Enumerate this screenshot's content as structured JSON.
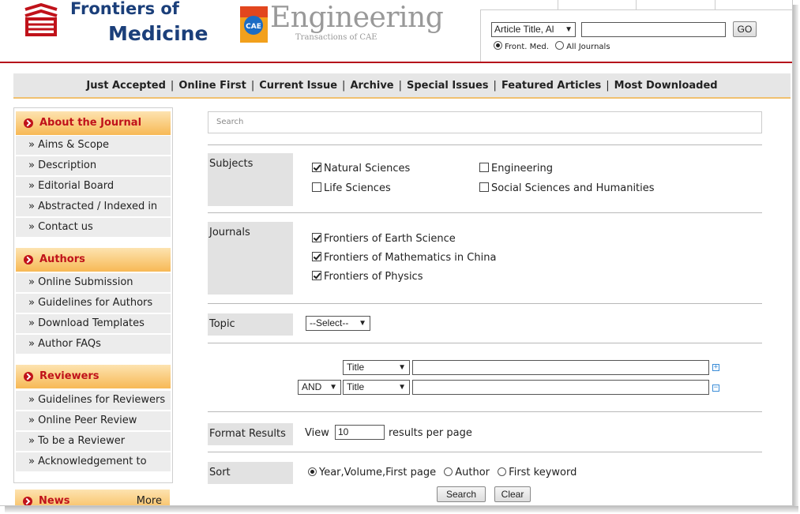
{
  "header": {
    "journal_line1": "Frontiers of",
    "journal_line2": "Medicine",
    "partner_badge_text": "CAE",
    "partner_title": "Engineering",
    "partner_subtitle": "Transactions of CAE"
  },
  "quick_search": {
    "field_select": "Article Title, Al",
    "query_value": "",
    "go_label": "GO",
    "scope_options": [
      {
        "label": "Front. Med.",
        "selected": true
      },
      {
        "label": "All Journals",
        "selected": false
      }
    ]
  },
  "nav": {
    "items": [
      "Just Accepted",
      "Online First",
      "Current Issue",
      "Archive",
      "Special Issues",
      "Featured Articles",
      "Most Downloaded"
    ]
  },
  "sidebar": {
    "sections": [
      {
        "title": "About the Journal",
        "items": [
          "» Aims & Scope",
          "» Description",
          "» Editorial Board",
          "» Abstracted / Indexed in",
          "» Contact us"
        ]
      },
      {
        "title": "Authors",
        "items": [
          "» Online Submission",
          "» Guidelines for Authors",
          "» Download Templates",
          "» Author FAQs"
        ]
      },
      {
        "title": "Reviewers",
        "items": [
          "» Guidelines for Reviewers",
          "» Online Peer Review",
          "» To be a Reviewer",
          "» Acknowledgement to"
        ]
      },
      {
        "title": "News",
        "more": "More",
        "items": []
      }
    ]
  },
  "advanced_search": {
    "search_placeholder": "Search",
    "subjects_label": "Subjects",
    "subjects": [
      {
        "label": "Natural Sciences",
        "checked": true
      },
      {
        "label": "Engineering",
        "checked": false
      },
      {
        "label": "Life Sciences",
        "checked": false
      },
      {
        "label": "Social Sciences and Humanities",
        "checked": false
      }
    ],
    "journals_label": "Journals",
    "journals": [
      {
        "label": "Frontiers of Earth Science",
        "checked": true
      },
      {
        "label": "Frontiers of Mathematics in China",
        "checked": true
      },
      {
        "label": "Frontiers of Physics",
        "checked": true
      }
    ],
    "topic_label": "Topic",
    "topic_select": "--Select--",
    "field_row1_select": "Title",
    "field_row2_operator": "AND",
    "field_row2_select": "Title",
    "format_label": "Format Results",
    "view_label": "View",
    "per_page_value": "10",
    "per_page_suffix": "results per page",
    "sort_label": "Sort",
    "sort_options": [
      {
        "label": "Year,Volume,First page",
        "selected": true
      },
      {
        "label": "Author",
        "selected": false
      },
      {
        "label": "First keyword",
        "selected": false
      }
    ],
    "search_button": "Search",
    "clear_button": "Clear"
  },
  "colors": {
    "brand_blue": "#1b3f7a",
    "accent_red": "#b5121b",
    "sidebar_header": "#f7b955"
  }
}
